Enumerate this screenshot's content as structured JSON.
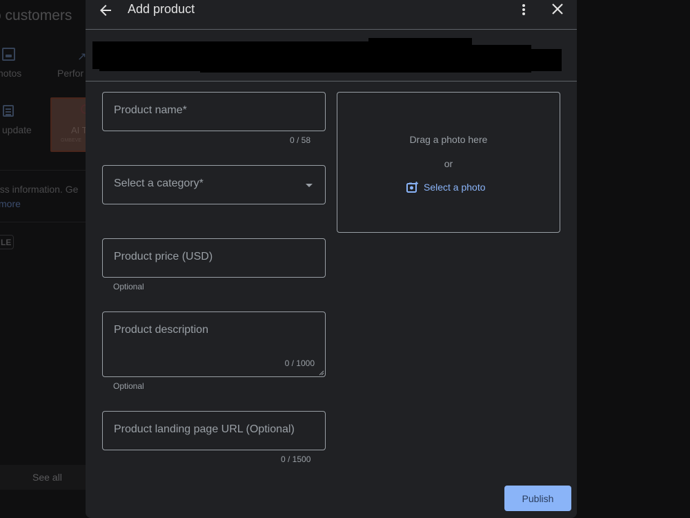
{
  "background_page": {
    "title": "o customers",
    "actions": [
      {
        "label": "hotos",
        "icon": "photo-icon"
      },
      {
        "label": "Perfor",
        "icon": "performance-icon"
      },
      {
        "label": "l update",
        "icon": "post-update-icon"
      }
    ],
    "ai_card": {
      "label": "AI T",
      "sub": "GMBEVE"
    },
    "info_text": "ess information. Ge",
    "learn_more": "more",
    "chip": "LE",
    "see_all": "See all"
  },
  "dialog": {
    "title": "Add product",
    "back_icon": "arrow-back-icon",
    "more_icon": "more-vert-icon",
    "close_icon": "close-icon",
    "fields": {
      "product_name": {
        "placeholder": "Product name*",
        "counter": "0 / 58",
        "value": ""
      },
      "category": {
        "placeholder": "Select a category*",
        "value": ""
      },
      "price": {
        "placeholder": "Product price (USD)",
        "helper": "Optional",
        "value": ""
      },
      "description": {
        "placeholder": "Product description",
        "counter": "0 / 1000",
        "helper": "Optional",
        "value": ""
      },
      "landing_url": {
        "placeholder": "Product landing page URL (Optional)",
        "counter": "0 / 1500",
        "value": ""
      }
    },
    "photo": {
      "drag_text": "Drag a photo here",
      "or_text": "or",
      "select_label": "Select a photo",
      "select_icon": "add-photo-icon"
    },
    "publish_label": "Publish"
  },
  "colors": {
    "dialog_bg": "#202124",
    "accent": "#8ab4f8",
    "border": "#9aa0a6",
    "text_secondary": "#9aa0a6"
  }
}
